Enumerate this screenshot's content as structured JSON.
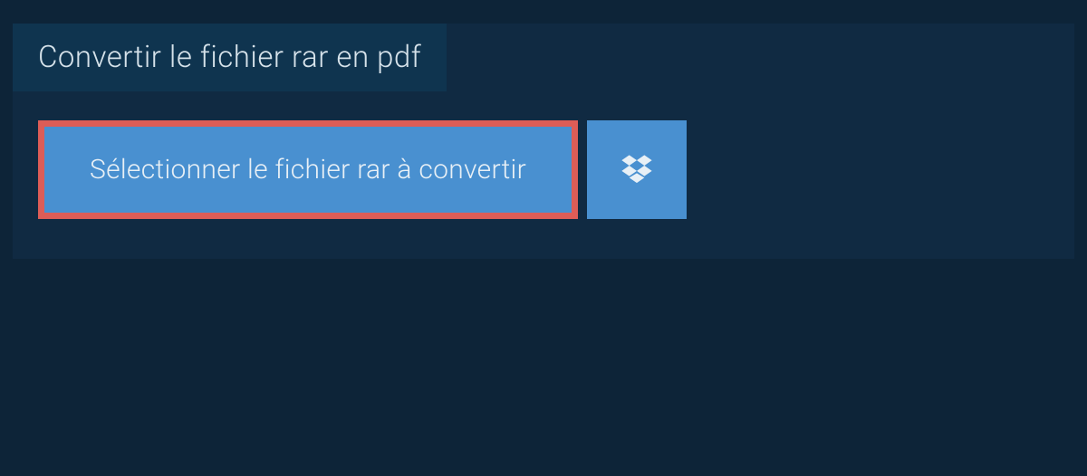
{
  "header": {
    "title": "Convertir le fichier rar en pdf"
  },
  "actions": {
    "select_file_label": "Sélectionner le fichier rar à convertir"
  },
  "colors": {
    "page_bg": "#0d2438",
    "panel_bg": "#102a42",
    "title_bg": "#0f344f",
    "button_bg": "#4990d0",
    "highlight_border": "#dd5d57",
    "text_light": "#d6e2ea"
  }
}
